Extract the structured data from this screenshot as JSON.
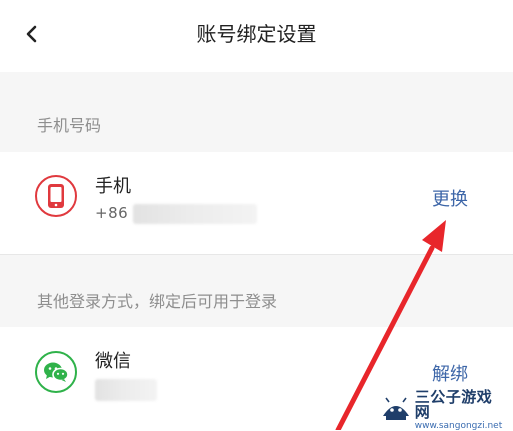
{
  "header": {
    "title": "账号绑定设置",
    "back_icon": "chevron-left-icon"
  },
  "phone_section": {
    "label": "手机号码",
    "item": {
      "icon": "phone-icon",
      "icon_color": "#e0393e",
      "title": "手机",
      "number_prefix": "+86 ",
      "action": "更换"
    }
  },
  "other_section": {
    "label": "其他登录方式，绑定后可用于登录",
    "item": {
      "icon": "wechat-icon",
      "icon_color": "#2fb24a",
      "title": "微信",
      "action": "解绑"
    }
  },
  "colors": {
    "link": "#3d66a8",
    "annotation_arrow": "#e8262b",
    "section_bg": "#f6f6f6"
  },
  "watermark": {
    "name": "三公子游戏网",
    "url": "www.sangongzi.net"
  }
}
